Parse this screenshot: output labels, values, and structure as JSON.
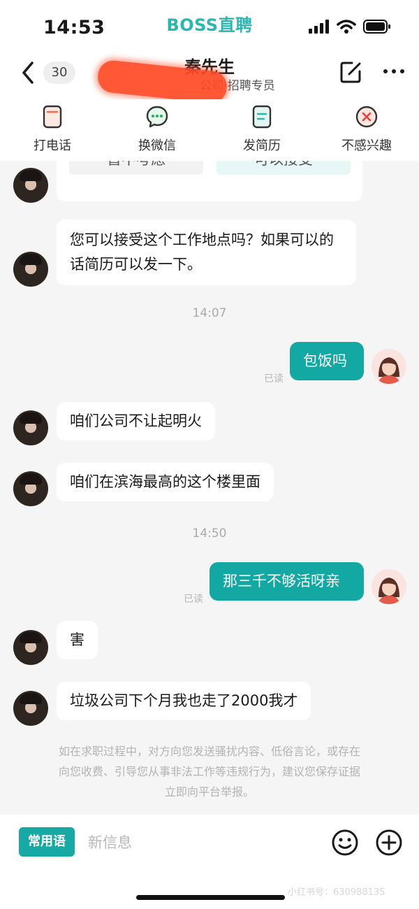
{
  "status_bar": {
    "time": "14:53",
    "app_brand": "BOSS直聘"
  },
  "header": {
    "unread_count": "30",
    "contact_name": "秦先生",
    "contact_subtitle": "公司·招聘专员"
  },
  "actions": [
    {
      "label": "打电话",
      "icon": "phone-icon"
    },
    {
      "label": "换微信",
      "icon": "wechat-icon"
    },
    {
      "label": "发简历",
      "icon": "resume-icon"
    },
    {
      "label": "不感兴趣",
      "icon": "not-interested-icon"
    }
  ],
  "chat": {
    "choice_card": {
      "decline": "暂不考虑",
      "accept": "可以接受"
    },
    "msg1": "您可以接受这个工作地点吗？如果可以的话简历可以发一下。",
    "time1": "14:07",
    "msg2": "包饭吗",
    "msg3": "咱们公司不让起明火",
    "msg4": "咱们在滨海最高的这个楼里面",
    "time2": "14:50",
    "msg5": "那三千不够活呀亲",
    "msg6": "害",
    "msg7": "垃圾公司下个月我也走了2000我才",
    "read_label": "已读",
    "warning": "如在求职过程中，对方向您发送骚扰内容、低俗言论，或存在向您收费、引导您从事非法工作等违规行为，建议您保存证据立即向平台举报。"
  },
  "input_bar": {
    "phrases_label": "常用语",
    "placeholder": "新信息",
    "watermark": "小红书号：630988135"
  },
  "colors": {
    "brand": "#2ab7b0",
    "bubble_out": "#14a8a2",
    "page_bg": "#f5f5f5"
  }
}
